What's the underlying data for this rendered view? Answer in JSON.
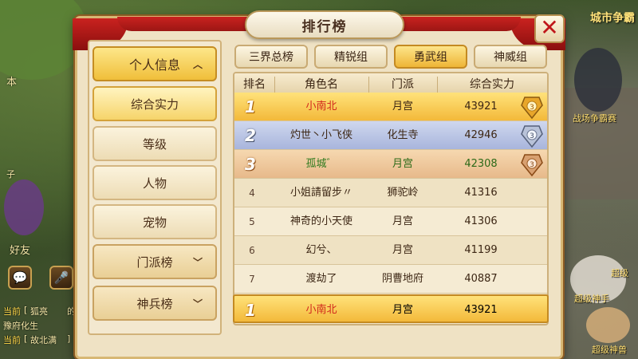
{
  "panel": {
    "title": "排行榜",
    "close_label": "✕"
  },
  "categories": [
    {
      "label": "个人信息",
      "state": "header"
    },
    {
      "label": "综合实力",
      "state": "active"
    },
    {
      "label": "等级",
      "state": "normal"
    },
    {
      "label": "人物",
      "state": "normal"
    },
    {
      "label": "宠物",
      "state": "normal"
    },
    {
      "label": "门派榜",
      "state": "collapsed"
    },
    {
      "label": "神兵榜",
      "state": "collapsed"
    }
  ],
  "tabs": [
    {
      "label": "三界总榜",
      "active": false
    },
    {
      "label": "精锐组",
      "active": false
    },
    {
      "label": "勇武组",
      "active": true
    },
    {
      "label": "神威组",
      "active": false
    }
  ],
  "table": {
    "headers": [
      "排名",
      "角色名",
      "门派",
      "综合实力"
    ],
    "rows": [
      {
        "rank": "1",
        "name": "小南北",
        "faction": "月宫",
        "power": "43921"
      },
      {
        "rank": "2",
        "name": "灼世丶小飞侠",
        "faction": "化生寺",
        "power": "42946"
      },
      {
        "rank": "3",
        "name": "孤城゛",
        "faction": "月宫",
        "power": "42308"
      },
      {
        "rank": "4",
        "name": "小姐請留步〃",
        "faction": "狮驼岭",
        "power": "41316"
      },
      {
        "rank": "5",
        "name": "神奇的小天使",
        "faction": "月宫",
        "power": "41306"
      },
      {
        "rank": "6",
        "name": "幻兮、",
        "faction": "月宫",
        "power": "41199"
      },
      {
        "rank": "7",
        "name": "渡劫了",
        "faction": "阴曹地府",
        "power": "40887"
      }
    ],
    "self": {
      "rank": "1",
      "name": "小南北",
      "faction": "月宫",
      "power": "43921"
    }
  },
  "background": {
    "left_texts": [
      "本",
      "子",
      "好友",
      "当前",
      "[",
      "狐亮",
      "的",
      "豫府化生",
      "当前",
      "[",
      "故北满",
      "]"
    ],
    "right_texts": [
      "城市争霸",
      "战场争霸赛",
      "超级",
      "超级神手",
      "超级神兽"
    ]
  },
  "colors": {
    "accent_gold": "#f0bf3a",
    "rank_red": "#d2281c",
    "close_red": "#c0161a"
  }
}
